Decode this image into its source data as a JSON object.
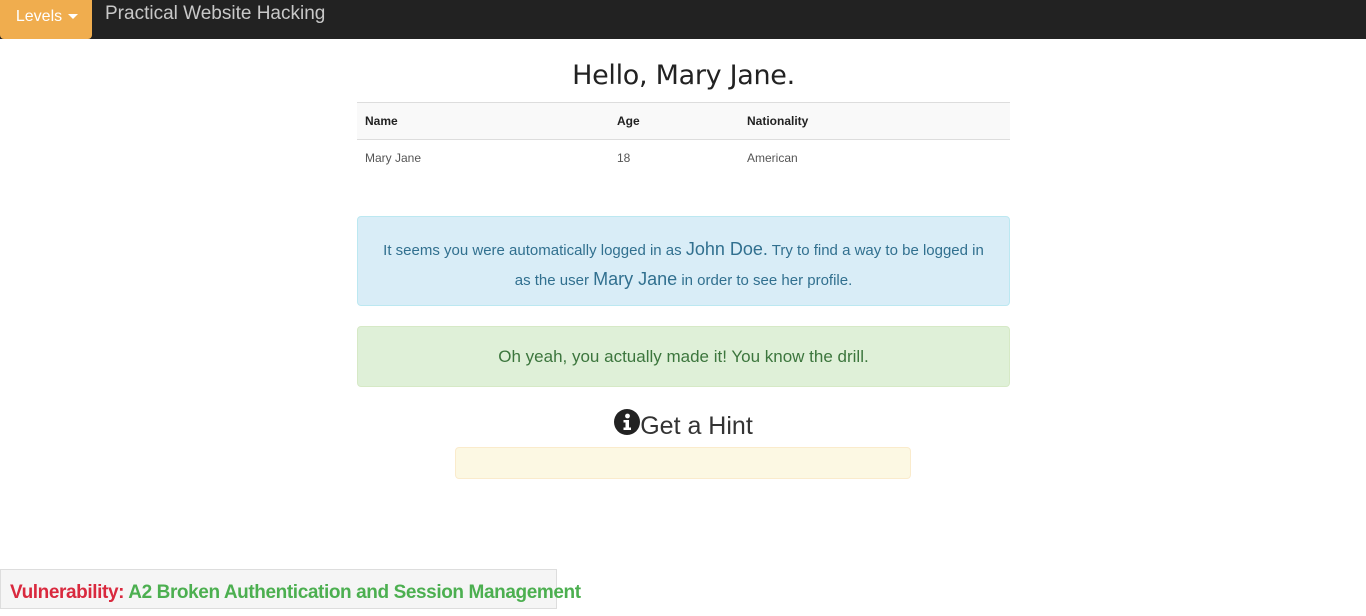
{
  "navbar": {
    "levels_label": "Levels",
    "brand": "Practical Website Hacking"
  },
  "main": {
    "greeting": "Hello, Mary Jane.",
    "table": {
      "headers": [
        "Name",
        "Age",
        "Nationality"
      ],
      "rows": [
        [
          "Mary Jane",
          "18",
          "American"
        ]
      ]
    },
    "info_alert": {
      "text_before": "It seems you were automatically logged in as ",
      "user_current": "John Doe.",
      "text_middle": " Try to find a way to be logged in as the user ",
      "user_target": "Mary Jane",
      "text_after": " in order to see her profile."
    },
    "success_alert": "Oh yeah, you actually made it! You know the drill.",
    "hint": {
      "icon": "info-circle-icon",
      "title": "Get a Hint",
      "content": ""
    }
  },
  "footer": {
    "vulnerability_label": "Vulnerability:",
    "vulnerability_value": "A2 Broken Authentication and Session Management"
  },
  "colors": {
    "navbar_bg": "#222222",
    "levels_btn_bg": "#f0ad4e",
    "info_bg": "#d9edf7",
    "success_bg": "#dff0d8",
    "hint_bg": "#fcf8e3",
    "vuln_label": "#d9293e",
    "vuln_value": "#4caf50"
  }
}
